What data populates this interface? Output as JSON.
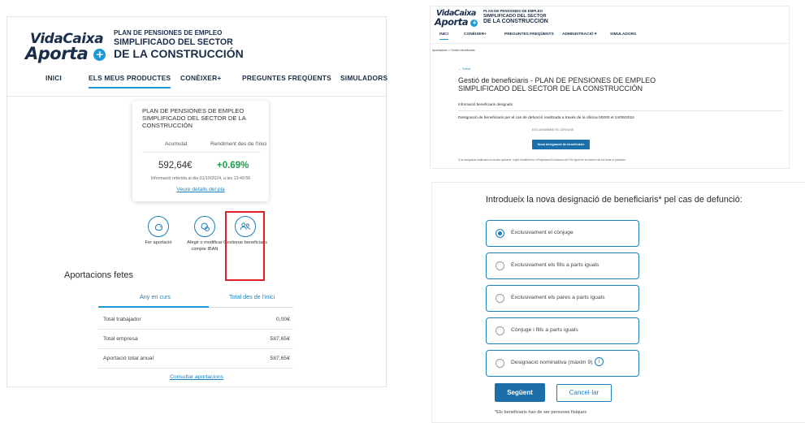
{
  "panel1": {
    "logo": {
      "line1": "VidaCaixa",
      "line2": "Aporta",
      "plus": "+"
    },
    "plan_title": [
      "PLAN DE PENSIONES DE EMPLEO",
      "SIMPLIFICADO DEL SECTOR",
      "DE LA CONSTRUCCIÓN"
    ],
    "nav": [
      "INICI",
      "ELS MEUS PRODUCTES",
      "CONÈIXER+",
      "PREGUNTES FREQÜENTS",
      "SIMULADORS"
    ],
    "card": {
      "title": "PLAN DE PENSIONES DE EMPLEO SIMPLIFICADO DEL SECTOR DE LA CONSTRUCCIÓN",
      "label_acumulat": "Acumulat",
      "label_rendiment": "Rendiment des de l'inici",
      "amount": "592,64€",
      "yield": "+0.69%",
      "info": "Informació referida al dia 01/10/2024, a les 13:49:56",
      "link": "Veure detalls del pla"
    },
    "actions": [
      {
        "icon": "piggy-bank-icon",
        "label": "Fer aportació"
      },
      {
        "icon": "bank-account-icon",
        "label": "Afegir o modificar compte IBAN"
      },
      {
        "icon": "users-icon",
        "label": "Gestionar beneficiaris"
      }
    ],
    "aportacions_title": "Aportacions fetes",
    "tabs": [
      "Any en curs",
      "Total des de l'inici"
    ],
    "rows": [
      {
        "label": "Total trabajador",
        "value": "0,00€"
      },
      {
        "label": "Total empresa",
        "value": "587,65€"
      },
      {
        "label": "Aportació total anual",
        "value": "587,65€"
      }
    ],
    "consult_link": "Consultar aportacions"
  },
  "panel2": {
    "logo": {
      "line1": "VidaCaixa",
      "line2": "Aporta"
    },
    "plan_title": [
      "PLAN DE PENSIONES DE EMPLEO",
      "SIMPLIFICADO DEL SECTOR",
      "DE LA CONSTRUCCIÓN"
    ],
    "nav": [
      "INICI",
      "CONÈIXER+",
      "PREGUNTES FREQÜENTS",
      "ADMINISTRACIÓ ▾",
      "SIMULADORS"
    ],
    "breadcrumb": "Aportacions  >  Gestió beneficiaris",
    "back": "← Tornar",
    "title": "Gestió de beneficiaris - PLAN DE PENSIONES DE EMPLEO SIMPLIFICADO DEL SECTOR DE LA CONSTRUCCIÓN",
    "info_heading": "Informació beneficiaris designats",
    "designation": "Designació de beneficiaris per el cas de defunció realitzada a través de la oficina 00000 el 24/06/2024",
    "exclusive": "EXCLUSIVAMENT EL CÒNYUGE",
    "new_button": "Nova designació de beneficiaris",
    "footnote": "Si la designació realitzada no resulta aplicable, regirà l'establert en el Reglament/Condicions del Pla vigent en el moment de sol·licitar la prestació."
  },
  "panel3": {
    "title": "Introdueix la nova designació de beneficiaris* pel cas de defunció:",
    "options": [
      "Exclusivament el cònjuge",
      "Exclusivament els fills a parts iguals",
      "Exclusivament els pares a parts iguals",
      "Cònjuge i fills a parts iguals",
      "Designació nominativa (màxim 9)"
    ],
    "selected_index": 0,
    "next_button": "Següent",
    "cancel_button": "Cancel·lar",
    "footnote": "*Els beneficiaris han de ser persones físiques"
  },
  "colors": {
    "brand_navy": "#1a2e4a",
    "accent_blue": "#1b9ad6",
    "link_blue": "#1c7fbc",
    "positive_green": "#1b9b4a",
    "highlight_red": "#e31f26"
  }
}
